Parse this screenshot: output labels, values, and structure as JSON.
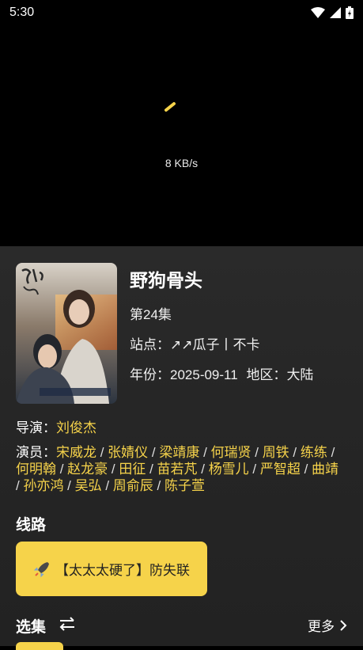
{
  "status_bar": {
    "time": "5:30"
  },
  "player": {
    "speed": "8 KB/s"
  },
  "show": {
    "title": "野狗骨头",
    "episode": "第24集",
    "site_label": "站点：",
    "site_value": "↗↗瓜子丨不卡",
    "year_label": "年份：",
    "year_value": "2025-09-11",
    "region_label": "地区：",
    "region_value": "大陆",
    "director_label": "导演：",
    "director": "刘俊杰",
    "actors_label": "演员：",
    "actors": [
      "宋威龙",
      "张婧仪",
      "梁靖康",
      "何瑞贤",
      "周铁",
      "练练",
      "何明翰",
      "赵龙豪",
      "田征",
      "苗若芃",
      "杨雪儿",
      "严智超",
      "曲靖",
      "孙亦鸿",
      "吴弘",
      "周俞辰",
      "陈子萱"
    ]
  },
  "routes": {
    "section_title": "线路",
    "button_label": "【太太太硬了】防失联"
  },
  "episodes": {
    "section_title": "选集",
    "more_label": "更多"
  },
  "colors": {
    "accent": "#f6d34a"
  }
}
